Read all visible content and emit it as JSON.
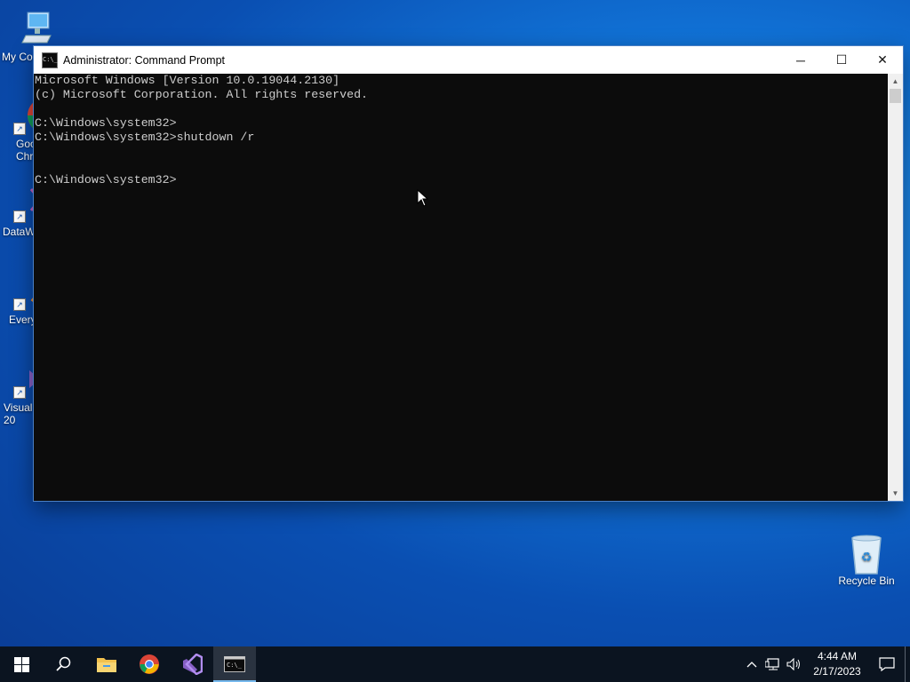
{
  "desktop": {
    "icons": [
      {
        "label": "My Co",
        "icon": "computer-icon"
      },
      {
        "label": "Goo Chr",
        "icon": "chrome-icon"
      },
      {
        "label": "DataW",
        "icon": "datawarrior-icon"
      },
      {
        "label": "Every",
        "icon": "everything-icon"
      },
      {
        "label": "Visual 20",
        "icon": "visual-studio-icon"
      }
    ],
    "recycle_bin": {
      "label": "Recycle Bin",
      "icon": "recycle-bin-icon"
    }
  },
  "window": {
    "title": "Administrator:  Command Prompt",
    "icon": "cmd-icon",
    "icon_text": "C:\\_",
    "controls": {
      "minimize": "─",
      "maximize": "☐",
      "close": "✕"
    },
    "console_text": "Microsoft Windows [Version 10.0.19044.2130]\n(c) Microsoft Corporation. All rights reserved.\n\nC:\\Windows\\system32>\nC:\\Windows\\system32>shutdown /r\n\n\nC:\\Windows\\system32>"
  },
  "taskbar": {
    "items": [
      {
        "name": "start-button",
        "icon": "windows-logo-icon"
      },
      {
        "name": "search-button",
        "icon": "search-icon"
      },
      {
        "name": "file-explorer-button",
        "icon": "folder-icon"
      },
      {
        "name": "chrome-button",
        "icon": "chrome-icon"
      },
      {
        "name": "visual-studio-button",
        "icon": "visual-studio-icon"
      },
      {
        "name": "cmd-taskbar-button",
        "icon": "cmd-icon",
        "active": true
      }
    ],
    "tray": {
      "chevron": "^",
      "time": "4:44 AM",
      "date": "2/17/2023"
    }
  },
  "colors": {
    "console_bg": "#0c0c0c",
    "console_text": "#cccccc",
    "taskbar_bg": "#0b1420",
    "desktop_accent": "#1174d8"
  }
}
